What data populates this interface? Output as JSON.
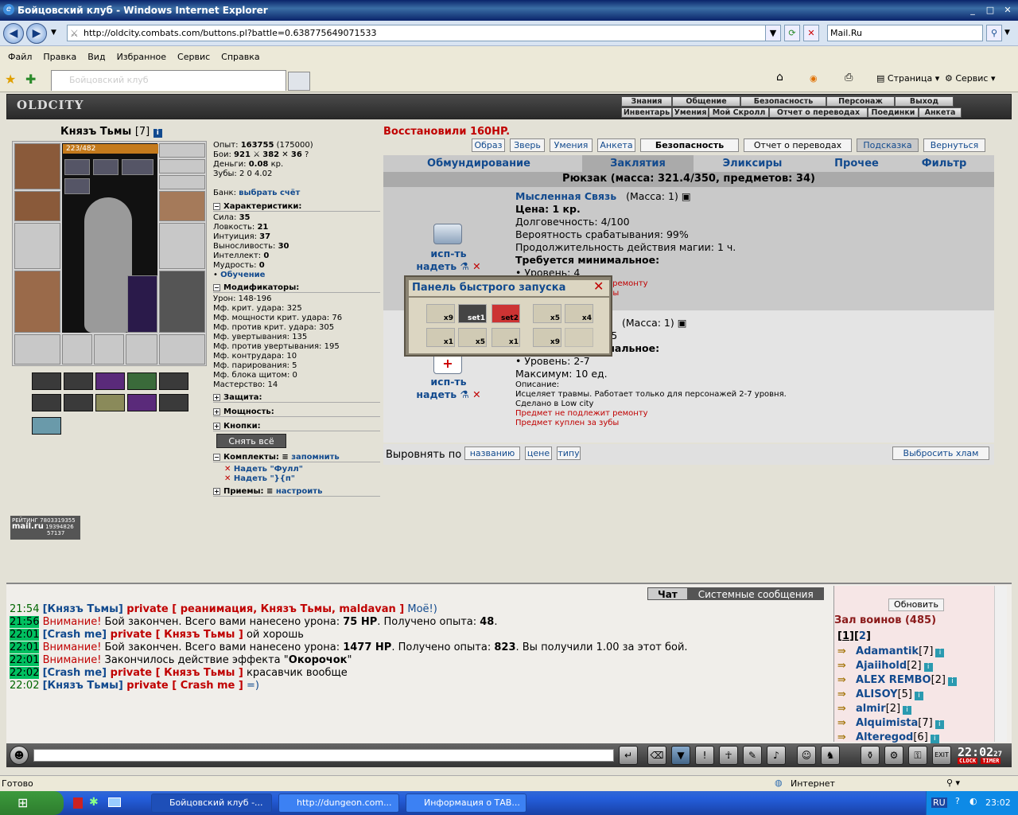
{
  "window": {
    "title": "Бойцовский клуб - Windows Internet Explorer"
  },
  "address": {
    "url": "http://oldcity.combats.com/buttons.pl?battle=0.638775649071533",
    "search": "Mail.Ru"
  },
  "menu": [
    "Файл",
    "Правка",
    "Вид",
    "Избранное",
    "Сервис",
    "Справка"
  ],
  "tab": {
    "title": "Бойцовский клуб"
  },
  "toolbar": {
    "page": "Страница",
    "service": "Сервис"
  },
  "game": {
    "logo": "OLDCITY",
    "topnav1": [
      "Знания",
      "Общение",
      "Безопасность",
      "Персонаж",
      "Выход"
    ],
    "topnav2": [
      "Инвентарь",
      "Умения",
      "Мой Скролл",
      "Отчет о переводах",
      "Поединки",
      "Анкета"
    ]
  },
  "character": {
    "name": "Князъ Тьмы",
    "level": "[7]",
    "hp": "223/482",
    "hp_fraction": 0.46
  },
  "stats": {
    "exp_label": "Опыт:",
    "exp": "163755",
    "exp_next": "(175000)",
    "fights_label": "Бои:",
    "wins": "921",
    "losses": "382",
    "draws": "36",
    "money_label": "Деньги:",
    "money": "0.08",
    "money_unit": "кр.",
    "teeth_label": "Зубы:",
    "teeth": "2 0 4.02",
    "bank_label": "Банк:",
    "bank_link": "выбрать счёт"
  },
  "sections": {
    "characteristics": "Характеристики:",
    "modifiers": "Модификаторы:",
    "protection": "Защита:",
    "power": "Мощность:",
    "buttons": "Кнопки:",
    "sets": "Комплекты:",
    "sets_link": "запомнить",
    "moves": "Приемы:",
    "moves_link": "настроить"
  },
  "characteristics": [
    {
      "label": "Сила:",
      "value": "35"
    },
    {
      "label": "Ловкость:",
      "value": "21"
    },
    {
      "label": "Интуиция:",
      "value": "37"
    },
    {
      "label": "Выносливость:",
      "value": "30"
    },
    {
      "label": "Интеллект:",
      "value": "0"
    },
    {
      "label": "Мудрость:",
      "value": "0"
    }
  ],
  "training_link": "Обучение",
  "modifiers": [
    "Урон: 148-196",
    "Мф. крит. удара: 325",
    "Мф. мощности крит. удара: 76",
    "Мф. против крит. удара: 305",
    "Мф. увертывания: 135",
    "Мф. против увертывания: 195",
    "Мф. контрудара: 10",
    "Мф. парирования: 5",
    "Мф. блока щитом: 0",
    "Мастерство: 14"
  ],
  "remove_all": "Снять всё",
  "sets": [
    "Надеть \"Фулл\"",
    "Надеть \"}{п\""
  ],
  "rating": {
    "label": "РЕЙТИНГ",
    "num1": "7803319355",
    "num2": "19394826",
    "num3": "57137",
    "brand": "mail.ru"
  },
  "main": {
    "recovered": "Восстановили 160HP.",
    "buttons": [
      "Образ",
      "Зверь",
      "Умения",
      "Анкета",
      "Безопасность",
      "Отчет о переводах",
      "Подсказка",
      "Вернуться"
    ],
    "tabs": [
      "Обмундирование",
      "Заклятия",
      "Эликсиры",
      "Прочее",
      "Фильтр"
    ],
    "rucksack": "Рюкзак (масса: 321.4/350, предметов: 34)",
    "use_label": "исп-ть",
    "wear_label": "надеть",
    "item1": {
      "name": "Мысленная Связь",
      "mass": "(Масса: 1)",
      "price": "Цена: 1 кр.",
      "durability": "Долговечность: 4/100",
      "chance": "Вероятность срабатывания: 99%",
      "duration": "Продолжительность действия магии: 1 ч.",
      "req": "Требуется минимальное:",
      "level": "• Уровень: 4",
      "note1": "Предмет не подлежит ремонту",
      "note2": "Предмет куплен за зубы"
    },
    "item2": {
      "mass": "(Масса: 1)",
      "durability": "/5",
      "req": "Требуется минимальное:",
      "level": "• Уровень: 2-7",
      "max": "Максимум: 10 ед.",
      "desc_label": "Описание:",
      "desc": "Исцеляет травмы. Работает только для персонажей 2-7 уровня.",
      "made": "Сделано в Low city",
      "note1": "Предмет не подлежит ремонту",
      "note2": "Предмет куплен за зубы"
    },
    "sort_label": "Выровнять по",
    "sort_buttons": [
      "названию",
      "цене",
      "типу"
    ],
    "trash": "Выбросить хлам"
  },
  "quickpanel": {
    "title": "Панель быстрого запуска",
    "row1": [
      "x9",
      "set1",
      "set2",
      "x5",
      "x4"
    ],
    "row2": [
      "x1",
      "x5",
      "x1",
      "x9",
      ""
    ]
  },
  "chat": {
    "tabs": [
      "Чат",
      "Системные сообщения"
    ],
    "lines": [
      {
        "t": "21:54",
        "hl": false,
        "parts": [
          [
            "n",
            "[Князъ Тьмы]"
          ],
          [
            "p",
            " private [ реанимация, Князъ Тьмы, maldavan ]"
          ],
          [
            "b",
            " Моё!)"
          ]
        ]
      },
      {
        "t": "21:56",
        "hl": true,
        "parts": [
          [
            "r",
            "Внимание!"
          ],
          [
            "x",
            " Бой закончен. Всего вами нанесено урона: "
          ],
          [
            "B",
            "75 HP"
          ],
          [
            "x",
            ". Получено опыта: "
          ],
          [
            "B",
            "48"
          ],
          [
            "x",
            "."
          ]
        ]
      },
      {
        "t": "22:01",
        "hl": true,
        "parts": [
          [
            "n",
            "[Crash me]"
          ],
          [
            "p",
            " private [ Князъ Тьмы ]"
          ],
          [
            "x",
            " ой хорошь"
          ]
        ]
      },
      {
        "t": "22:01",
        "hl": true,
        "parts": [
          [
            "r",
            "Внимание!"
          ],
          [
            "x",
            " Бой закончен. Всего вами нанесено урона: "
          ],
          [
            "B",
            "1477 HP"
          ],
          [
            "x",
            ". Получено опыта: "
          ],
          [
            "B",
            "823"
          ],
          [
            "x",
            ". Вы получили 1.00 за этот бой."
          ]
        ]
      },
      {
        "t": "22:01",
        "hl": true,
        "parts": [
          [
            "r",
            "Внимание!"
          ],
          [
            "x",
            " Закончилось действие эффекта \""
          ],
          [
            "B",
            "Окорочок"
          ],
          [
            "x",
            "\""
          ]
        ]
      },
      {
        "t": "22:02",
        "hl": true,
        "parts": [
          [
            "n",
            "[Crash me]"
          ],
          [
            "p",
            " private [ Князъ Тьмы ]"
          ],
          [
            "x",
            " красавчик вообще"
          ]
        ]
      },
      {
        "t": "22:02",
        "hl": false,
        "parts": [
          [
            "n",
            "[Князъ Тьмы]"
          ],
          [
            "p",
            " private [ Crash me ]"
          ],
          [
            "b",
            " =)"
          ]
        ]
      }
    ]
  },
  "online": {
    "refresh": "Обновить",
    "hall": "Зал воинов (485)",
    "pages": [
      "1",
      "2"
    ],
    "users": [
      {
        "name": "Adamantik",
        "lvl": "[7]"
      },
      {
        "name": "Ajaiihold",
        "lvl": "[2]"
      },
      {
        "name": "ALEX REMBO",
        "lvl": "[2]"
      },
      {
        "name": "ALISOY",
        "lvl": "[5]"
      },
      {
        "name": "almir",
        "lvl": "[2]"
      },
      {
        "name": "Alquimista",
        "lvl": "[7]"
      },
      {
        "name": "Alteregod",
        "lvl": "[6]"
      }
    ]
  },
  "clock": {
    "time": "22:02",
    "sec": "27",
    "label1": "CLOCK",
    "label2": "TIMER"
  },
  "status": {
    "left": "Готово",
    "zone": "Интернет"
  },
  "taskbar": {
    "tasks": [
      "Бойцовский клуб -...",
      "http://dungeon.com...",
      "Информация о ТАВ..."
    ],
    "lang": "RU",
    "time": "23:02"
  }
}
